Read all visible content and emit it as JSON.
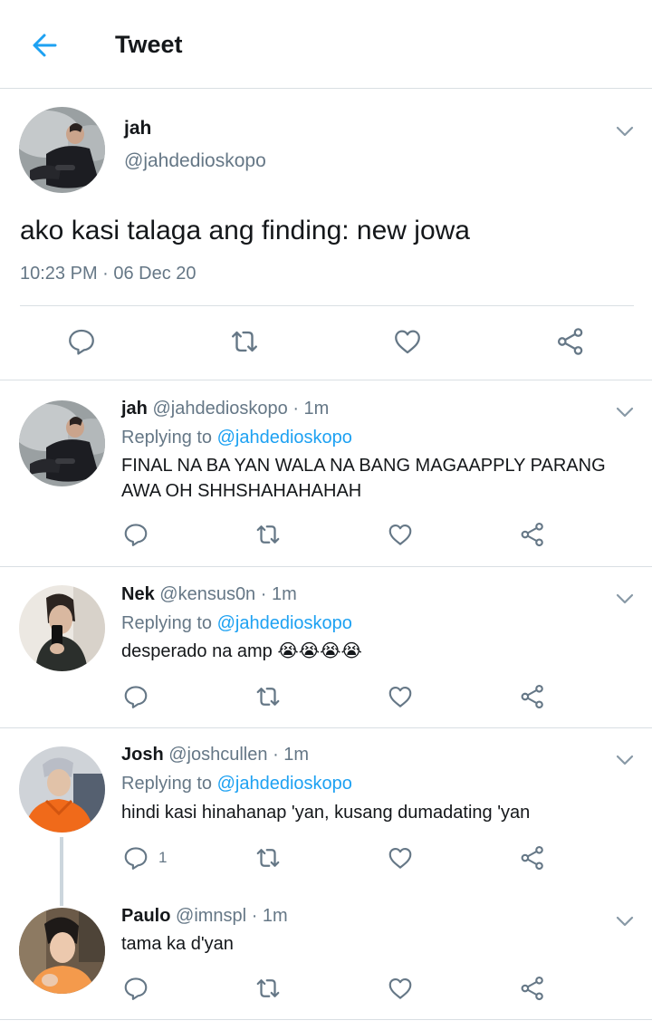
{
  "header": {
    "title": "Tweet"
  },
  "main_tweet": {
    "name": "jah",
    "handle": "@jahdedioskopo",
    "text": "ako kasi talaga ang finding: new jowa",
    "timestamp": "10:23 PM · 06 Dec 20"
  },
  "replies": [
    {
      "name": "jah",
      "handle": "@jahdedioskopo",
      "time": "· 1m",
      "replying_prefix": "Replying to",
      "replying_to": "@jahdedioskopo",
      "text": "FINAL NA BA YAN WALA NA BANG MAGAAPPLY PARANG AWA OH SHHSHAHAHAHAH",
      "reply_count": ""
    },
    {
      "name": "Nek",
      "handle": "@kensus0n",
      "time": "· 1m",
      "replying_prefix": "Replying to",
      "replying_to": "@jahdedioskopo",
      "text": "desperado na amp 😭😭😭😭",
      "reply_count": ""
    },
    {
      "name": "Josh",
      "handle": "@joshcullen",
      "time": "· 1m",
      "replying_prefix": "Replying to",
      "replying_to": "@jahdedioskopo",
      "text": "hindi kasi hinahanap 'yan, kusang dumadating 'yan",
      "reply_count": "1"
    },
    {
      "name": "Paulo",
      "handle": "@imnspl",
      "time": "· 1m",
      "text": "tama ka d'yan",
      "reply_count": ""
    }
  ],
  "colors": {
    "accent": "#1da1f2",
    "text": "#14171a",
    "secondary": "#657786",
    "icon": "#657786",
    "divider": "#d9dfe3"
  },
  "icons": {
    "back": "arrow-left-icon",
    "reply": "speech-bubble-icon",
    "retweet": "retweet-arrows-icon",
    "like": "heart-icon",
    "share": "share-nodes-icon",
    "more": "chevron-down-icon"
  }
}
